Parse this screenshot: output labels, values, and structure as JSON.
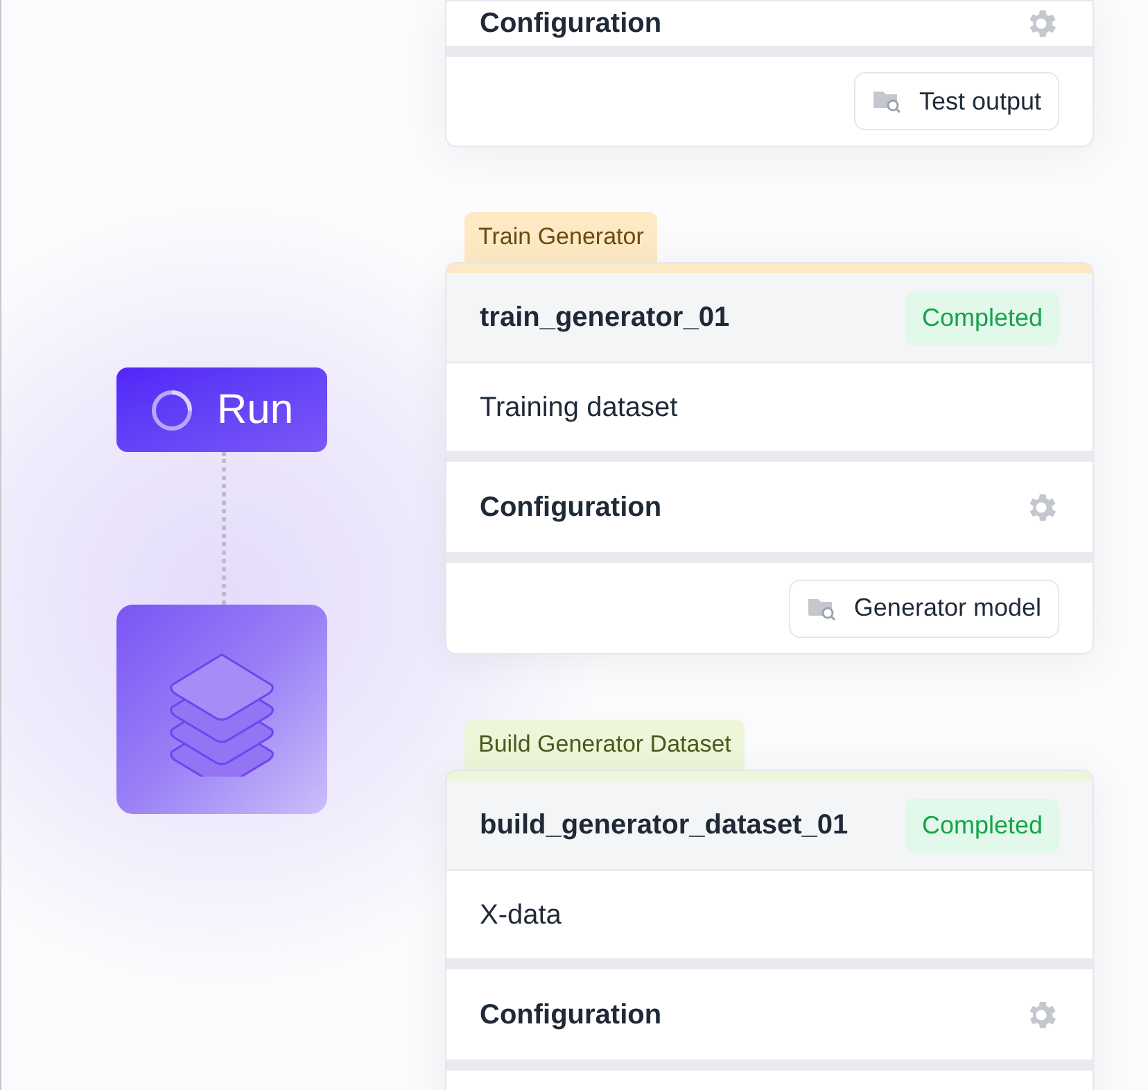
{
  "run_button": {
    "label": "Run",
    "running": true
  },
  "top_card": {
    "config_label": "Configuration",
    "button_label": "Test output"
  },
  "stages": [
    {
      "kind": "train",
      "tab": "Train Generator",
      "title": "train_generator_01",
      "status": "Completed",
      "description": "Training dataset",
      "config_label": "Configuration",
      "button_label": "Generator model"
    },
    {
      "kind": "build",
      "tab": "Build Generator Dataset",
      "title": "build_generator_dataset_01",
      "status": "Completed",
      "description": "X-data",
      "config_label": "Configuration"
    }
  ]
}
